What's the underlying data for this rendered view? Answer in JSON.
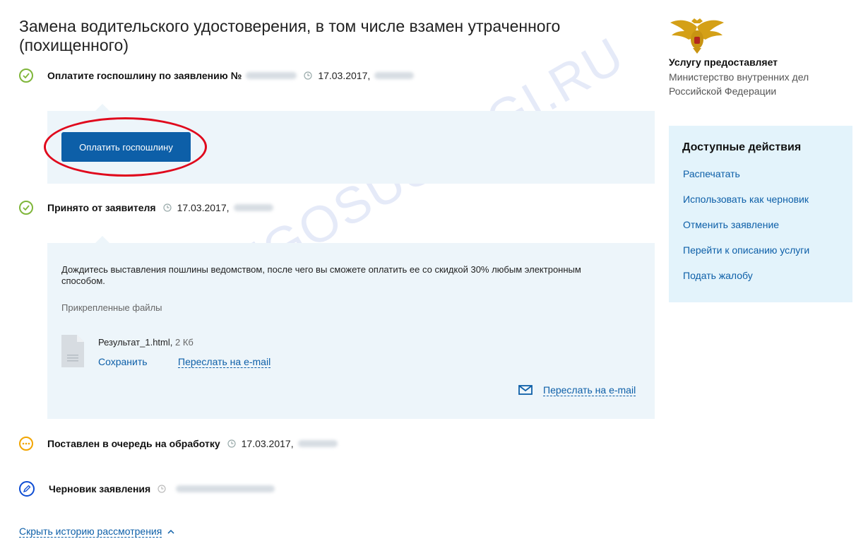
{
  "page": {
    "title": "Замена водительского удостоверения, в том числе взамен утраченного (похищенного)"
  },
  "steps": [
    {
      "label": "Оплатите госпошлину по заявлению",
      "number_prefix": "№",
      "date": "17.03.2017,",
      "status": "done"
    },
    {
      "label": "Принято от заявителя",
      "date": "17.03.2017,",
      "status": "done"
    },
    {
      "label": "Поставлен в очередь на обработку",
      "date": "17.03.2017,",
      "status": "pending"
    },
    {
      "label": "Черновик заявления",
      "status": "draft"
    }
  ],
  "pay_panel": {
    "button_label": "Оплатить госпошлину"
  },
  "accepted_panel": {
    "message": "Дождитесь выставления пошлины ведомством, после чего вы сможете оплатить ее со скидкой 30% любым электронным способом.",
    "files_heading": "Прикрепленные файлы",
    "file": {
      "name": "Результат_1.html,",
      "size": "2 Кб",
      "save_label": "Сохранить",
      "forward_label": "Переслать на e-mail"
    },
    "forward_all_label": "Переслать на e-mail"
  },
  "history": {
    "hide_label": "Скрыть историю рассмотрения"
  },
  "sidebar": {
    "provider_label": "Услугу предоставляет",
    "provider_name": "Министерство внутренних дел Российской Федерации",
    "actions_title": "Доступные действия",
    "actions": [
      "Распечатать",
      "Использовать как черновик",
      "Отменить заявление",
      "Перейти к описанию услуги",
      "Подать жалобу"
    ]
  },
  "watermark": "VSEGOSUSLUGI.RU",
  "colors": {
    "brand_blue": "#0d5fa8",
    "done_green": "#7fb63a",
    "pending_yellow": "#f2a500",
    "highlight_red": "#e0081c",
    "panel_bg": "#edf5fa",
    "sidebar_bg": "#e3f3fb"
  },
  "icons": {
    "done": "check-circle-icon",
    "pending": "dots-circle-icon",
    "draft": "pencil-circle-icon",
    "time": "clock-icon",
    "file": "document-icon",
    "mail": "envelope-icon",
    "collapse": "chevron-up-icon",
    "emblem": "double-headed-eagle-emblem"
  }
}
